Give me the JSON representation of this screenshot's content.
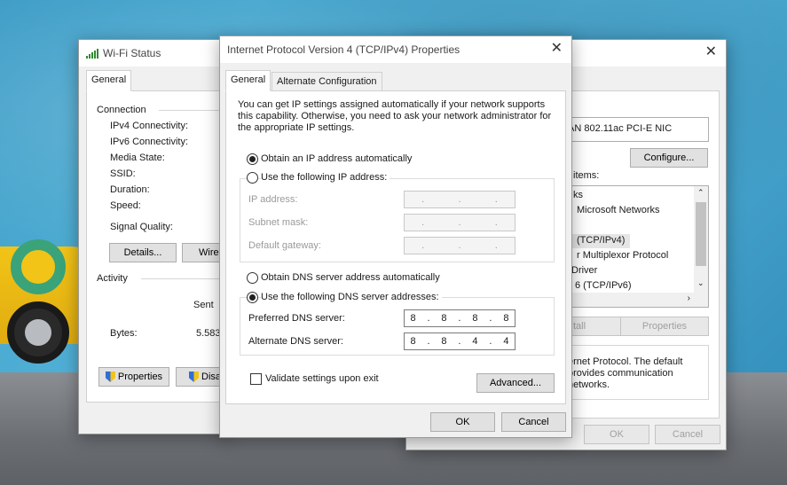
{
  "wifi_status": {
    "title": "Wi-Fi Status",
    "tab": "General",
    "connection_header": "Connection",
    "rows": [
      "IPv4 Connectivity:",
      "IPv6 Connectivity:",
      "Media State:",
      "SSID:",
      "Duration:",
      "Speed:"
    ],
    "signal_quality": "Signal Quality:",
    "details_button": "Details...",
    "wireless_button": "Wirel",
    "activity_header": "Activity",
    "sent_label": "Sent",
    "bytes_label": "Bytes:",
    "bytes_value": "5.583",
    "properties_button": "Properties",
    "disable_button": "Disa"
  },
  "adapter_props": {
    "adapter_name": "AN 802.11ac PCI-E NIC",
    "configure_button": "Configure...",
    "items_label": "items:",
    "list_items": [
      "ks",
      "Microsoft Networks",
      "",
      "(TCP/IPv4)",
      "r Multiplexor Protocol",
      "Driver",
      "6 (TCP/IPv6)"
    ],
    "install_button": "tall",
    "properties_button": "Properties",
    "description": "ernet Protocol. The default\nprovides communication\nnetworks.",
    "ok_button": "OK",
    "cancel_button": "Cancel"
  },
  "ipv4": {
    "title": "Internet Protocol Version 4 (TCP/IPv4) Properties",
    "tabs": [
      "General",
      "Alternate Configuration"
    ],
    "intro": "You can get IP settings assigned automatically if your network supports this capability. Otherwise, you need to ask your network administrator for the appropriate IP settings.",
    "obtain_ip_auto": "Obtain an IP address automatically",
    "use_following_ip": "Use the following IP address:",
    "ip_address_label": "IP address:",
    "subnet_mask_label": "Subnet mask:",
    "default_gateway_label": "Default gateway:",
    "obtain_dns_auto": "Obtain DNS server address automatically",
    "use_following_dns": "Use the following DNS server addresses:",
    "preferred_dns_label": "Preferred DNS server:",
    "preferred_dns": [
      "8",
      "8",
      "8",
      "8"
    ],
    "alternate_dns_label": "Alternate DNS server:",
    "alternate_dns": [
      "8",
      "8",
      "4",
      "4"
    ],
    "validate_label": "Validate settings upon exit",
    "advanced_button": "Advanced...",
    "ok_button": "OK",
    "cancel_button": "Cancel",
    "ip_selected": "auto",
    "dns_selected": "manual"
  }
}
